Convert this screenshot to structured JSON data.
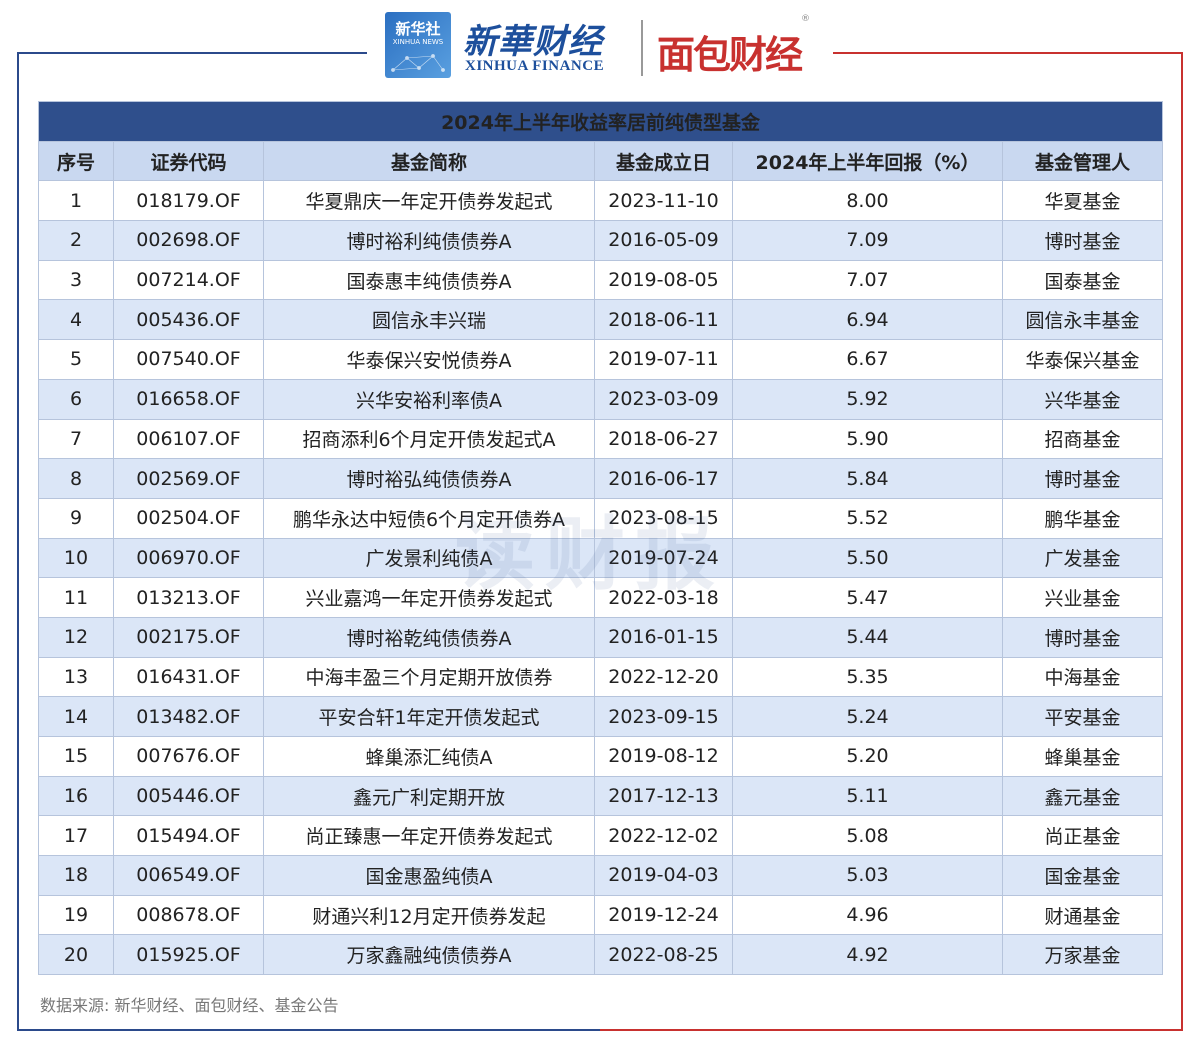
{
  "brand": {
    "xinhua_logo_cn": "新华社",
    "xinhua_logo_en": "XINHUA NEWS",
    "xinhua_finance_cn": "新華财经",
    "xinhua_finance_en": "XINHUA FINANCE",
    "mianbao": "面包财经",
    "registered_mark": "®"
  },
  "table": {
    "title": "2024年上半年收益率居前纯债型基金",
    "headers": [
      "序号",
      "证券代码",
      "基金简称",
      "基金成立日",
      "2024年上半年回报（%）",
      "基金管理人"
    ],
    "rows": [
      [
        "1",
        "018179.OF",
        "华夏鼎庆一年定开债券发起式",
        "2023-11-10",
        "8.00",
        "华夏基金"
      ],
      [
        "2",
        "002698.OF",
        "博时裕利纯债债券A",
        "2016-05-09",
        "7.09",
        "博时基金"
      ],
      [
        "3",
        "007214.OF",
        "国泰惠丰纯债债券A",
        "2019-08-05",
        "7.07",
        "国泰基金"
      ],
      [
        "4",
        "005436.OF",
        "圆信永丰兴瑞",
        "2018-06-11",
        "6.94",
        "圆信永丰基金"
      ],
      [
        "5",
        "007540.OF",
        "华泰保兴安悦债券A",
        "2019-07-11",
        "6.67",
        "华泰保兴基金"
      ],
      [
        "6",
        "016658.OF",
        "兴华安裕利率债A",
        "2023-03-09",
        "5.92",
        "兴华基金"
      ],
      [
        "7",
        "006107.OF",
        "招商添利6个月定开债发起式A",
        "2018-06-27",
        "5.90",
        "招商基金"
      ],
      [
        "8",
        "002569.OF",
        "博时裕弘纯债债券A",
        "2016-06-17",
        "5.84",
        "博时基金"
      ],
      [
        "9",
        "002504.OF",
        "鹏华永达中短债6个月定开债券A",
        "2023-08-15",
        "5.52",
        "鹏华基金"
      ],
      [
        "10",
        "006970.OF",
        "广发景利纯债A",
        "2019-07-24",
        "5.50",
        "广发基金"
      ],
      [
        "11",
        "013213.OF",
        "兴业嘉鸿一年定开债券发起式",
        "2022-03-18",
        "5.47",
        "兴业基金"
      ],
      [
        "12",
        "002175.OF",
        "博时裕乾纯债债券A",
        "2016-01-15",
        "5.44",
        "博时基金"
      ],
      [
        "13",
        "016431.OF",
        "中海丰盈三个月定期开放债券",
        "2022-12-20",
        "5.35",
        "中海基金"
      ],
      [
        "14",
        "013482.OF",
        "平安合轩1年定开债发起式",
        "2023-09-15",
        "5.24",
        "平安基金"
      ],
      [
        "15",
        "007676.OF",
        "蜂巢添汇纯债A",
        "2019-08-12",
        "5.20",
        "蜂巢基金"
      ],
      [
        "16",
        "005446.OF",
        "鑫元广利定期开放",
        "2017-12-13",
        "5.11",
        "鑫元基金"
      ],
      [
        "17",
        "015494.OF",
        "尚正臻惠一年定开债券发起式",
        "2022-12-02",
        "5.08",
        "尚正基金"
      ],
      [
        "18",
        "006549.OF",
        "国金惠盈纯债A",
        "2019-04-03",
        "5.03",
        "国金基金"
      ],
      [
        "19",
        "008678.OF",
        "财通兴利12月定开债券发起",
        "2019-12-24",
        "4.96",
        "财通基金"
      ],
      [
        "20",
        "015925.OF",
        "万家鑫融纯债债券A",
        "2022-08-25",
        "4.92",
        "万家基金"
      ]
    ]
  },
  "watermark": "读财报",
  "source": "数据来源: 新华财经、面包财经、基金公告"
}
